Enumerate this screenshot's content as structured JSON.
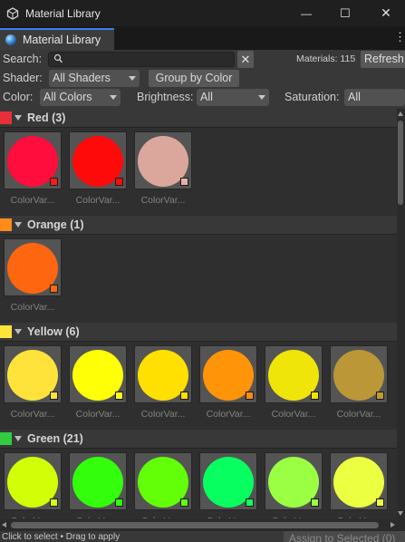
{
  "window": {
    "title": "Material Library",
    "minimize_glyph": "—",
    "maximize_glyph": "☐",
    "close_glyph": "✕"
  },
  "tab": {
    "label": "Material Library",
    "menu_glyph": "⋮"
  },
  "toolbar": {
    "search_label": "Search:",
    "search_value": "",
    "search_placeholder": "",
    "clear_glyph": "✕",
    "materials_count": "Materials: 115",
    "refresh_label": "Refresh"
  },
  "shader_row": {
    "shader_label": "Shader:",
    "shader_value": "All Shaders",
    "group_button": "Group by Color"
  },
  "filter_row": {
    "color_label": "Color:",
    "color_value": "All Colors",
    "brightness_label": "Brightness:",
    "brightness_value": "All",
    "saturation_label": "Saturation:",
    "saturation_value": "All"
  },
  "sections": [
    {
      "title": "Red (3)",
      "swatch": "#e8303a",
      "items": [
        {
          "label": "ColorVar...",
          "color": "#ff0d3c",
          "tag": "#ff1a1a"
        },
        {
          "label": "ColorVar...",
          "color": "#ff0a0a",
          "tag": "#ff0a0a"
        },
        {
          "label": "ColorVar...",
          "color": "#dba79d",
          "tag": "#e8b0a8"
        }
      ]
    },
    {
      "title": "Orange (1)",
      "swatch": "#ff8c1a",
      "items": [
        {
          "label": "ColorVar...",
          "color": "#ff6610",
          "tag": "#ff6a10"
        }
      ]
    },
    {
      "title": "Yellow (6)",
      "swatch": "#ffe43a",
      "items": [
        {
          "label": "ColorVar...",
          "color": "#ffe33a",
          "tag": "#ffe433"
        },
        {
          "label": "ColorVar...",
          "color": "#ffff05",
          "tag": "#ffff22"
        },
        {
          "label": "ColorVar...",
          "color": "#ffe000",
          "tag": "#ffe000"
        },
        {
          "label": "ColorVar...",
          "color": "#ff9408",
          "tag": "#ff8a10"
        },
        {
          "label": "ColorVar...",
          "color": "#f0e508",
          "tag": "#f0e400"
        },
        {
          "label": "ColorVar...",
          "color": "#bb9738",
          "tag": "#c29a30"
        }
      ]
    },
    {
      "title": "Green (21)",
      "swatch": "#32cc40",
      "items": [
        {
          "label": "ColorVar...",
          "color": "#d2ff08",
          "tag": "#ccff11"
        },
        {
          "label": "ColorVar...",
          "color": "#33ff0c",
          "tag": "#33ff11"
        },
        {
          "label": "ColorVar...",
          "color": "#62ff08",
          "tag": "#60ff10"
        },
        {
          "label": "ColorVar...",
          "color": "#08ff60",
          "tag": "#10ff60"
        },
        {
          "label": "ColorVar...",
          "color": "#9bff44",
          "tag": "#99ff44"
        },
        {
          "label": "ColorVar...",
          "color": "#ecff40",
          "tag": "#eaff44"
        }
      ]
    }
  ],
  "status": {
    "hint": "Click to select • Drag to apply",
    "assign_button": "Assign to Selected (0)"
  }
}
